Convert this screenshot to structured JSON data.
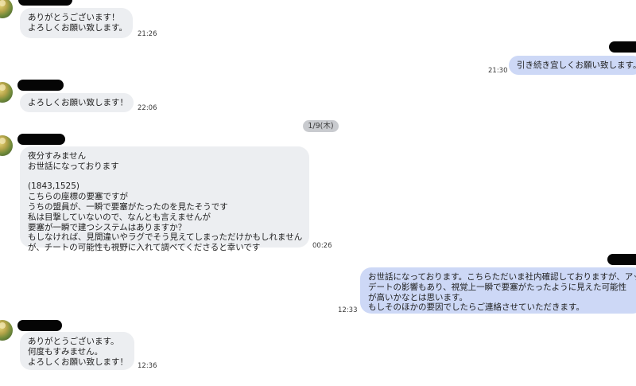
{
  "date_divider": "1/9(木)",
  "messages": [
    {
      "text": "ありがとうございます！\nよろしくお願い致します。",
      "time": "21:26"
    },
    {
      "text": "引き続き宜しくお願い致します。",
      "time": "21:30"
    },
    {
      "text": "よろしくお願い致します！",
      "time": "22:06"
    },
    {
      "text": "夜分すみません\nお世話になっております\n\n(1843,1525)\nこちらの座標の要塞ですが\nうちの盟員が、一瞬で要塞がたったのを見たそうです\n私は目撃していないので、なんとも言えませんが\n要塞が一瞬で建つシステムはありますか？\nもしなければ、見間違いやラグでそう見えてしまっただけかもしれません\nが、チートの可能性も視野に入れて調べてくださると幸いです",
      "time": "00:26"
    },
    {
      "text": "お世話になっております。こちらただいま社内確認しておりますが、アップ\nデートの影響もあり、視覚上一瞬で要塞がたったように見えた可能性\nが高いかなとは思います。\nもしそのほかの要因でしたらご連絡させていただきます。",
      "time": "12:33"
    },
    {
      "text": "ありがとうございます。\n何度もすみません。\nよろしくお願い致します！",
      "time": "12:36"
    }
  ]
}
